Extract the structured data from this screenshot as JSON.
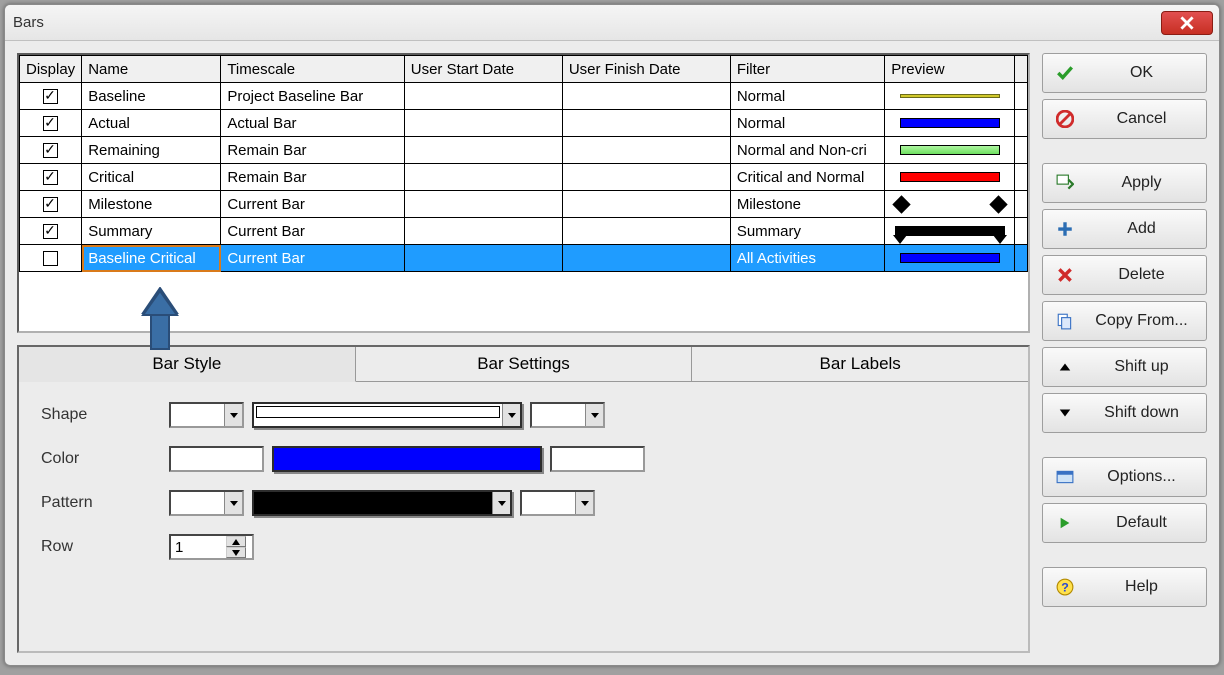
{
  "window": {
    "title": "Bars"
  },
  "table": {
    "headers": {
      "display": "Display",
      "name": "Name",
      "timescale": "Timescale",
      "userStart": "User Start Date",
      "userFinish": "User Finish Date",
      "filter": "Filter",
      "preview": "Preview"
    },
    "rows": [
      {
        "checked": true,
        "name": "Baseline",
        "timescale": "Project Baseline Bar",
        "userStart": "",
        "userFinish": "",
        "filter": "Normal",
        "preview": "yellow-thin"
      },
      {
        "checked": true,
        "name": "Actual",
        "timescale": "Actual Bar",
        "userStart": "",
        "userFinish": "",
        "filter": "Normal",
        "preview": "blue"
      },
      {
        "checked": true,
        "name": "Remaining",
        "timescale": "Remain Bar",
        "userStart": "",
        "userFinish": "",
        "filter": "Normal and Non-cri",
        "preview": "green"
      },
      {
        "checked": true,
        "name": "Critical",
        "timescale": "Remain Bar",
        "userStart": "",
        "userFinish": "",
        "filter": "Critical and Normal",
        "preview": "red"
      },
      {
        "checked": true,
        "name": "Milestone",
        "timescale": "Current Bar",
        "userStart": "",
        "userFinish": "",
        "filter": "Milestone",
        "preview": "milestone"
      },
      {
        "checked": true,
        "name": "Summary",
        "timescale": "Current Bar",
        "userStart": "",
        "userFinish": "",
        "filter": "Summary",
        "preview": "summary"
      },
      {
        "checked": true,
        "name": "Baseline Critical",
        "timescale": "Current Bar",
        "userStart": "",
        "userFinish": "",
        "filter": "All Activities",
        "preview": "solid-blue",
        "selected": true
      }
    ]
  },
  "tabs": {
    "style": "Bar Style",
    "settings": "Bar Settings",
    "labels": "Bar Labels"
  },
  "style": {
    "shapeLabel": "Shape",
    "colorLabel": "Color",
    "patternLabel": "Pattern",
    "rowLabel": "Row",
    "rowValue": "1",
    "colors": {
      "shapeMain": "#ffffff",
      "colorMain": "#0000ff",
      "patternMain": "#000000"
    }
  },
  "buttons": {
    "ok": "OK",
    "cancel": "Cancel",
    "apply": "Apply",
    "add": "Add",
    "delete": "Delete",
    "copyFrom": "Copy From...",
    "shiftUp": "Shift up",
    "shiftDown": "Shift down",
    "options": "Options...",
    "default": "Default",
    "help": "Help"
  }
}
